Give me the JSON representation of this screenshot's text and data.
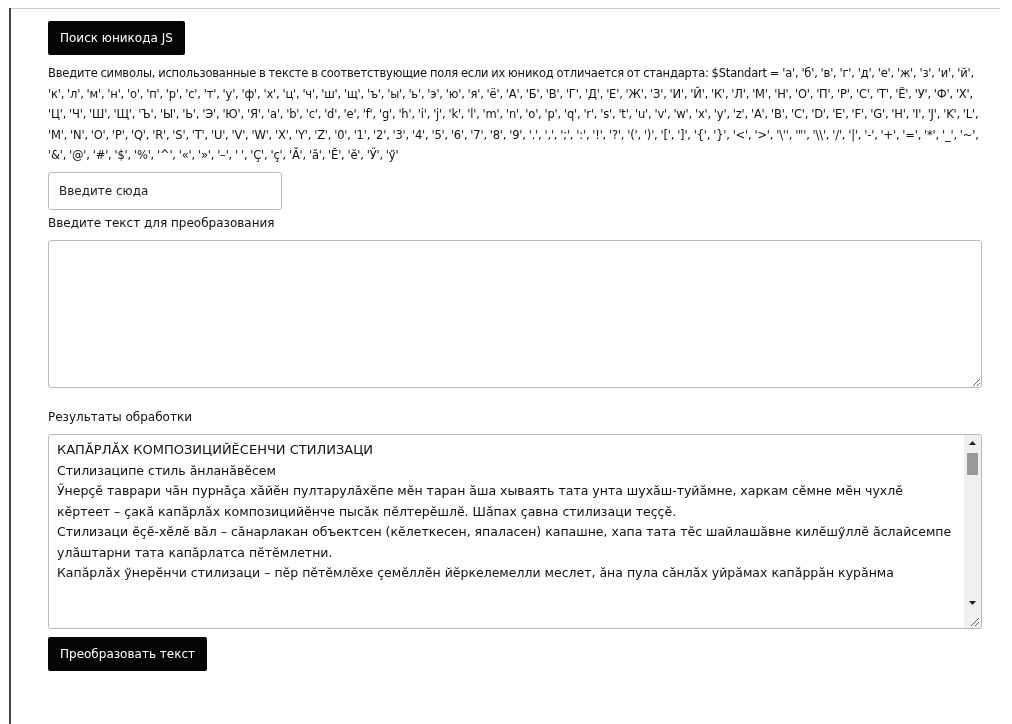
{
  "search_button": "Поиск юникода JS",
  "instructions": "Введите символы, использованные в тексте в соответствующие поля если их юникод отличается от стандарта: $Standart = 'а', 'б', 'в', 'г', 'д', 'е', 'ж', 'з', 'и', 'й', 'к', 'л', 'м', 'н', 'о', 'п', 'р', 'с', 'т', 'у', 'ф', 'х', 'ц', 'ч', 'ш', 'щ', 'ъ', 'ы', 'ь', 'э', 'ю', 'я', 'ё', 'А', 'Б', 'В', 'Г', 'Д', 'Е', 'Ж', 'З', 'И', 'Й', 'К', 'Л', 'М', 'Н', 'О', 'П', 'Р', 'С', 'Т', 'Ё', 'У', 'Ф', 'Х', 'Ц', 'Ч', 'Ш', 'Щ', 'Ъ', 'Ы', 'Ь', 'Э', 'Ю', 'Я', 'a', 'b', 'c', 'd', 'e', 'f', 'g', 'h', 'i', 'j', 'k', 'l', 'm', 'n', 'o', 'p', 'q', 'r', 's', 't', 'u', 'v', 'w', 'x', 'y', 'z', 'A', 'B', 'C', 'D', 'E', 'F', 'G', 'H', 'I', 'J', 'K', 'L', 'M', 'N', 'O', 'P', 'Q', 'R', 'S', 'T', 'U', 'V', 'W', 'X', 'Y', 'Z', '0', '1', '2', '3', '4', '5', '6', '7', '8', '9', '.', ',', ';', ':', '!', '?', '(', ')', '[', ']', '{', '}', '<', '>', '\\'', '\"', '\\\\', '/', '|', '-', '+', '=', '*', '_', '~', '&', '@', '#', '$', '%', '^', '«', '»', '–', ' ', 'Ç', 'ç', 'Ă', 'ă', 'Ĕ', 'ĕ', 'Ӳ', 'ӳ'",
  "symbol_field": {
    "placeholder": "Введите сюда"
  },
  "input_label": "Введите текст для преобразования",
  "results_label": "Результаты обработки",
  "results": [
    "КАПĂРЛĂХ КОМПОЗИЦИЙĔСЕНЧИ СТИЛИЗАЦИ",
    "Стилизаципе стиль ăнланăвĕсем",
    "Ӳнерçĕ таврари чăн пурнăçа хăйĕн пултарулăхĕпе мĕн таран ăша хываять тата унта шухăш-туйăмне, харкам сĕмне мĕн чухлĕ кĕртеет – çакă капăрлăх композицийĕнче пысăк пĕлтерĕшлĕ. Шăпах çавна стилизаци теççĕ.",
    "Стилизаци ĕçĕ-хĕлĕ вăл – сăнарлакан объектсен (кĕлеткесен, япаласен) капашне, хапа тата тĕс шайлашăвне килĕшӳллĕ ăслайсемпе улăштарни тата капăрлатса пĕтĕмлетни.",
    "Капăрлăх ӳнерĕнчи стилизаци – пĕр пĕтĕмлĕхе çемĕллĕн йĕркелемелли меслет, ăна пула сăнлăх уйрăмах капăррăн курăнма"
  ],
  "convert_button": "Преобразовать текст"
}
